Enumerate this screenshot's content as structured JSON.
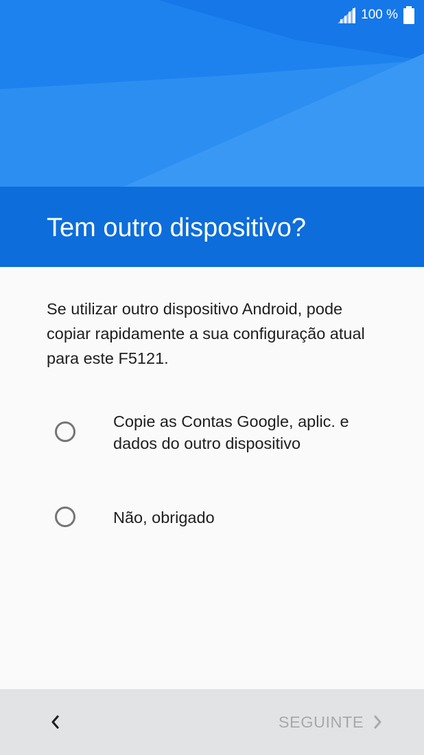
{
  "status_bar": {
    "battery_text": "100 %",
    "signal_icon": "signal-icon",
    "battery_icon": "battery-icon"
  },
  "header": {
    "title": "Tem outro dispositivo?"
  },
  "main": {
    "description": "Se utilizar outro dispositivo Android, pode copiar rapidamente a sua configuração atual para este F5121.",
    "options": [
      {
        "label": "Copie as Contas Google, aplic. e dados do outro dispositivo",
        "selected": false
      },
      {
        "label": "Não, obrigado",
        "selected": false
      }
    ]
  },
  "footer": {
    "back_icon": "chevron-left-icon",
    "next_label": "SEGUINTE",
    "next_icon": "chevron-right-icon",
    "next_enabled": false
  },
  "colors": {
    "header_light": "#2d8ef2",
    "header_band": "#0d6ddb",
    "background": "#fafafa",
    "footer_bg": "#e1e3e5",
    "disabled_text": "#a7a9ab"
  }
}
